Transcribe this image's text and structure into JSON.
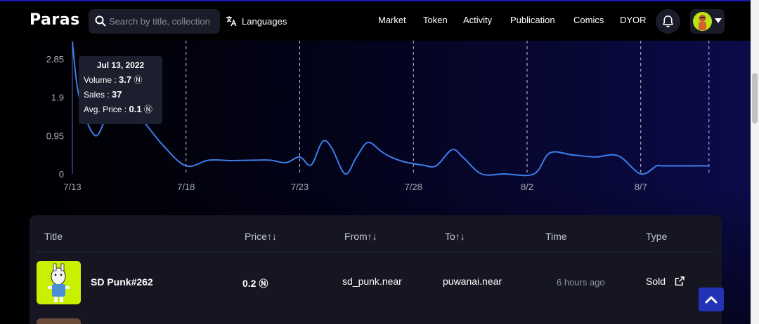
{
  "nav": {
    "logo": "Paras",
    "search_placeholder": "Search by title, collection",
    "languages_label": "Languages",
    "menu": [
      "Market",
      "Token",
      "Activity",
      "Publication",
      "Comics",
      "DYOR"
    ]
  },
  "colors": {
    "accent": "#2233b6",
    "line": "#3d7eea",
    "avatar_bg": "#b6e614",
    "thumb_bg": "#c8f000"
  },
  "tooltip": {
    "date": "Jul 13, 2022",
    "volume_label": "Volume : ",
    "volume_value": "3.7",
    "sales_label": "Sales : ",
    "sales_value": "37",
    "avg_label": "Avg. Price : ",
    "avg_value": "0.1",
    "currency_symbol": "Ⓝ"
  },
  "chart_data": {
    "type": "line",
    "title": "",
    "xlabel": "",
    "ylabel": "",
    "yticks": [
      "0",
      "0.95",
      "1.9",
      "2.85"
    ],
    "xticks": [
      "7/13",
      "7/18",
      "7/23",
      "7/28",
      "8/2",
      "8/7"
    ],
    "ylim": [
      0,
      3.5
    ],
    "grid": "vertical dashed",
    "series": [
      {
        "values": [
          [
            0,
            3.6
          ],
          [
            0.3,
            1.9
          ],
          [
            1,
            0.95
          ],
          [
            1.6,
            1.5
          ],
          [
            2.5,
            1.75
          ],
          [
            3,
            1.4
          ],
          [
            4,
            0.7
          ],
          [
            5,
            0.2
          ],
          [
            6,
            0.34
          ],
          [
            7,
            0.33
          ],
          [
            8,
            0.34
          ],
          [
            8.7,
            0.34
          ],
          [
            9.4,
            0.28
          ],
          [
            10,
            0.42
          ],
          [
            10.5,
            0.22
          ],
          [
            11,
            0.8
          ],
          [
            11.4,
            0.65
          ],
          [
            12,
            0.0
          ],
          [
            12.5,
            0.42
          ],
          [
            13,
            0.78
          ],
          [
            13.6,
            0.55
          ],
          [
            14,
            0.42
          ],
          [
            14.6,
            0.3
          ],
          [
            15.4,
            0.22
          ],
          [
            16,
            0.2
          ],
          [
            16.7,
            0.6
          ],
          [
            17.2,
            0.4
          ],
          [
            18,
            0.0
          ],
          [
            19,
            0.0
          ],
          [
            20.3,
            0.0
          ],
          [
            21,
            0.52
          ],
          [
            22,
            0.47
          ],
          [
            23,
            0.42
          ],
          [
            24,
            0.45
          ],
          [
            25,
            0.0
          ],
          [
            25.7,
            0.2
          ],
          [
            26,
            0.2
          ],
          [
            28,
            0.2
          ]
        ]
      }
    ]
  },
  "table": {
    "headers": [
      "Title",
      "Price↑↓",
      "From↑↓",
      "To↑↓",
      "Time",
      "Type"
    ],
    "rows": [
      {
        "title": "SD Punk#262",
        "price": "0.2",
        "from": "sd_punk.near",
        "to": "puwanai.near",
        "time": "6 hours ago",
        "type": "Sold"
      }
    ]
  }
}
